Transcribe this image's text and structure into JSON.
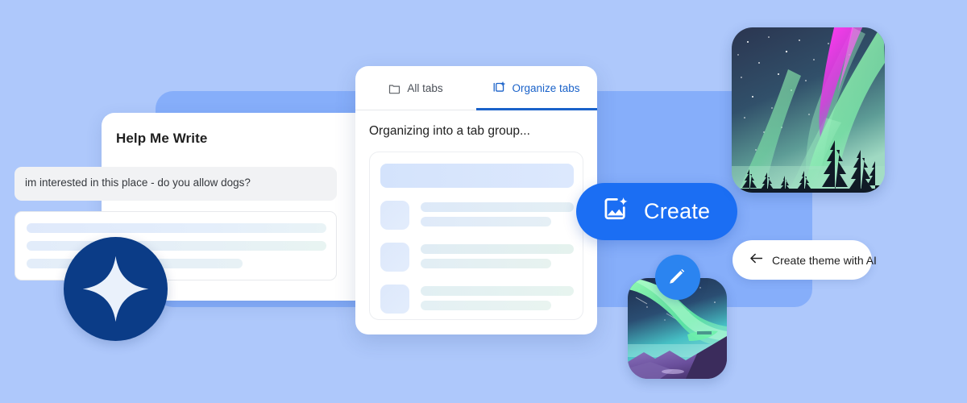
{
  "theme": {
    "page_background": "#aec8fb",
    "panel_background": "#86aefa",
    "accent_blue": "#1b6ef3",
    "tab_active_blue": "#1a62c9",
    "gemini_navy": "#0b3c87",
    "pencil_blue": "#2b84f0",
    "card_white": "#ffffff"
  },
  "help_me_write": {
    "title": "Help Me Write",
    "prompt_value": "im interested in this place - do you allow dogs?",
    "skeleton_lines": 3
  },
  "tabs_card": {
    "tabs": [
      {
        "label": "All tabs",
        "icon": "tab-group-icon",
        "active": false
      },
      {
        "label": "Organize tabs",
        "icon": "new-tab-group-icon",
        "active": true
      }
    ],
    "heading": "Organizing into a tab group...",
    "group_rows": 3
  },
  "gemini_badge": {
    "icon": "gemini-sparkle-icon"
  },
  "create_button": {
    "label": "Create",
    "icon": "image-sparkle-icon"
  },
  "theme_chip": {
    "label": "Create theme with AI",
    "icon": "arrow-left-icon"
  },
  "aurora_photo": {
    "alt": "aurora-borealis-photo"
  },
  "aurora_thumbnail": {
    "alt": "aurora-illustration-thumbnail",
    "badge_icon": "pencil-icon"
  }
}
